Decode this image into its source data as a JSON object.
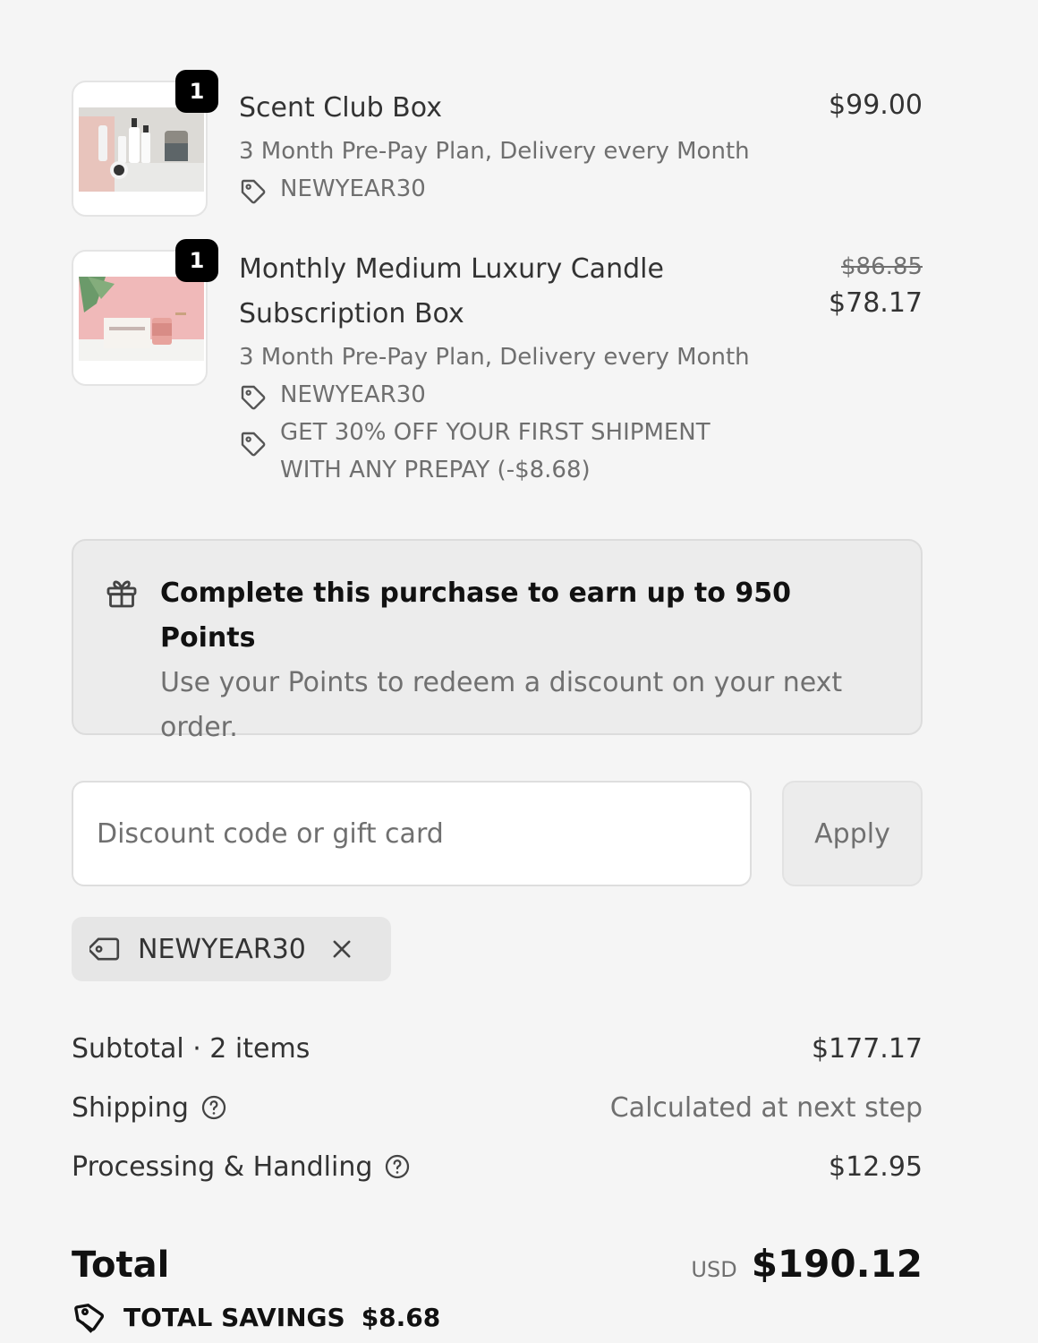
{
  "items": [
    {
      "quantity": "1",
      "title_line1": "Scent Club Box",
      "title_line2": "",
      "variant": "3 Month Pre-Pay Plan, Delivery every Month",
      "discounts": [
        "NEWYEAR30"
      ],
      "original_price": "",
      "price": "$99.00"
    },
    {
      "quantity": "1",
      "title_line1": "Monthly Medium Luxury Candle",
      "title_line2": "Subscription Box",
      "variant": "3 Month Pre-Pay Plan, Delivery every Month",
      "discounts": [
        "NEWYEAR30",
        "GET 30% OFF YOUR FIRST SHIPMENT",
        "WITH ANY PREPAY (-$8.68)"
      ],
      "original_price": "$86.85",
      "price": "$78.17"
    }
  ],
  "rewards": {
    "title": "Complete this purchase to earn up to 950 Points",
    "subtitle_line1": "Use your Points to redeem a discount on your next",
    "subtitle_line2": "order."
  },
  "discount": {
    "placeholder": "Discount code or gift card",
    "value": "",
    "apply_label": "Apply",
    "applied_code": "NEWYEAR30"
  },
  "summary": {
    "subtotal_label": "Subtotal · 2 items",
    "subtotal_value": "$177.17",
    "shipping_label": "Shipping",
    "shipping_value": "Calculated at next step",
    "processing_label": "Processing & Handling",
    "processing_value": "$12.95",
    "total_label": "Total",
    "currency": "USD",
    "total_value": "$190.12",
    "savings_label": "TOTAL SAVINGS",
    "savings_value": "$8.68"
  },
  "icons": {
    "tag": "tag-icon",
    "gift": "gift-icon",
    "close": "close-icon",
    "help": "help-circle-icon"
  },
  "colors": {
    "background": "#f5f5f5",
    "badge": "#000000",
    "text_primary": "#333333",
    "text_muted": "#707070"
  }
}
